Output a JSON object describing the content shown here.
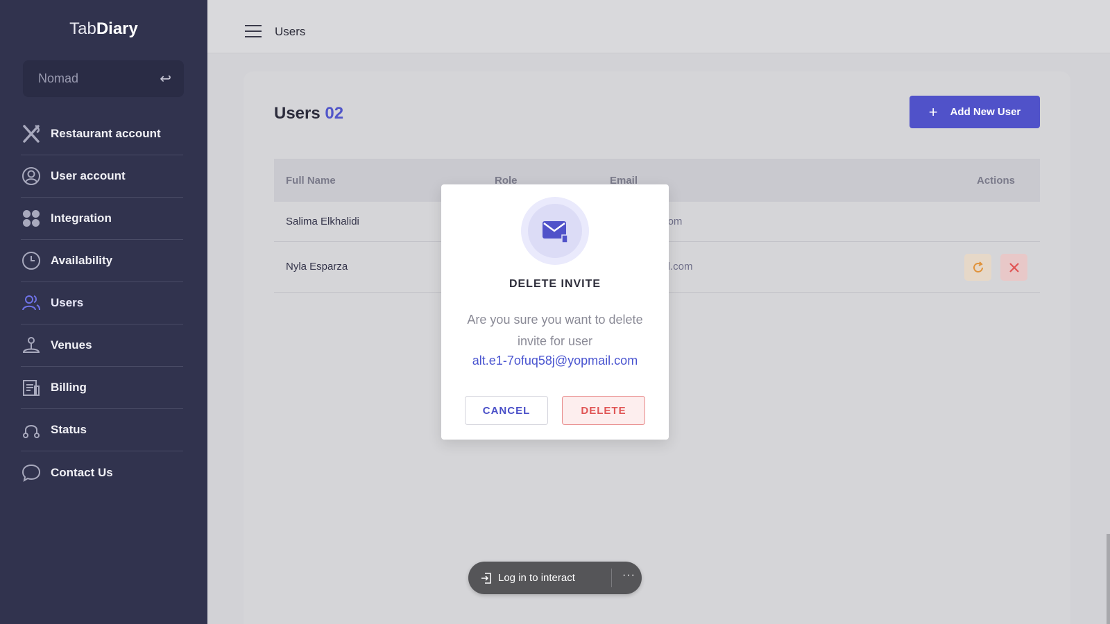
{
  "app": {
    "logo_light": "Tab",
    "logo_bold": "Diary"
  },
  "venue": {
    "name": "Nomad"
  },
  "sidebar": {
    "items": [
      {
        "label": "Restaurant account",
        "icon": "utensils-icon"
      },
      {
        "label": "User account",
        "icon": "user-circle-icon"
      },
      {
        "label": "Integration",
        "icon": "grid-icon"
      },
      {
        "label": "Availability",
        "icon": "clock-icon"
      },
      {
        "label": "Users",
        "icon": "users-icon",
        "active": true
      },
      {
        "label": "Venues",
        "icon": "venue-icon"
      },
      {
        "label": "Billing",
        "icon": "billing-icon"
      },
      {
        "label": "Status",
        "icon": "status-icon"
      },
      {
        "label": "Contact Us",
        "icon": "chat-icon"
      }
    ]
  },
  "topbar": {
    "title": "Users"
  },
  "page": {
    "heading": "Users",
    "count": "02",
    "add_button": "Add New User"
  },
  "table": {
    "headers": {
      "name": "Full Name",
      "role": "Role",
      "email": "Email",
      "actions": "Actions"
    },
    "rows": [
      {
        "name": "Salima Elkhalidi",
        "role": "",
        "email": "ma@gmail.com"
      },
      {
        "name": "Nyla Esparza",
        "role": "",
        "email": "58j@yopmail.com"
      }
    ]
  },
  "modal": {
    "title": "DELETE INVITE",
    "message": "Are you sure you want to delete invite for user",
    "email": "alt.e1-7ofuq58j@yopmail.com",
    "cancel": "CANCEL",
    "delete": "DELETE"
  },
  "overlay": {
    "login_label": "Log in to interact",
    "more": "···"
  },
  "colors": {
    "accent": "#5052c9",
    "sidebar": "#31334e",
    "danger": "#e05555",
    "warning": "#e0923a"
  }
}
